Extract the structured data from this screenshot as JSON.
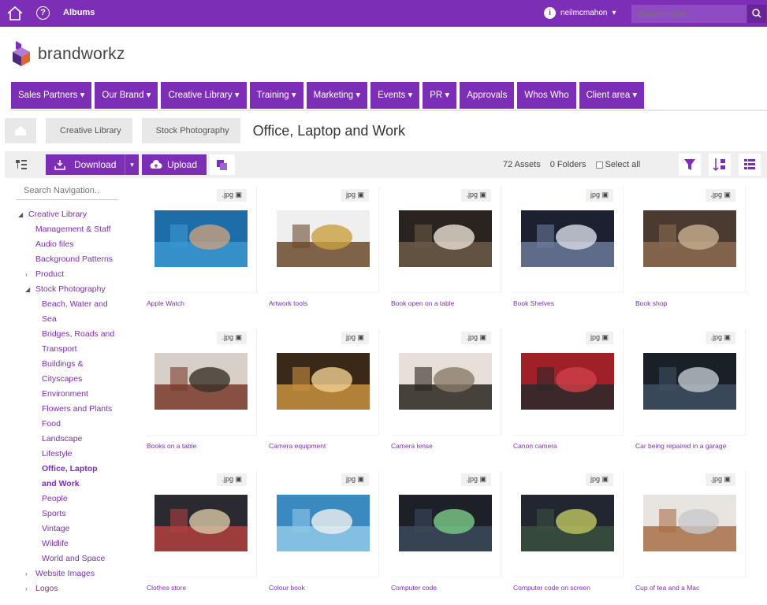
{
  "topbar": {
    "home_icon": "home-icon",
    "help_icon": "help-icon",
    "help_glyph": "?",
    "albums_label": "Albums",
    "user_initial": "i",
    "username": "neilmcmahon",
    "user_caret": "▾",
    "search_placeholder": "Search site..."
  },
  "brand": {
    "name": "brandworkz",
    "mark": "·"
  },
  "colors": {
    "accent": "#7c2fb6"
  },
  "nav": [
    {
      "label": "Sales Partners ▾"
    },
    {
      "label": "Our Brand ▾"
    },
    {
      "label": "Creative Library ▾"
    },
    {
      "label": "Training ▾"
    },
    {
      "label": "Marketing ▾"
    },
    {
      "label": "Events ▾"
    },
    {
      "label": "PR ▾"
    },
    {
      "label": "Approvals"
    },
    {
      "label": "Whos Who"
    },
    {
      "label": "Client area ▾"
    }
  ],
  "breadcrumb": {
    "items": [
      "Creative Library",
      "Stock Photography"
    ],
    "current": "Office, Laptop and Work"
  },
  "toolbar": {
    "download_label": "Download",
    "download_caret": "▾",
    "upload_label": "Upload",
    "assets": "72 Assets",
    "folders": "0 Folders",
    "select_all": "Select all"
  },
  "sidebar": {
    "search_placeholder": "Search Navigation..",
    "tree": [
      {
        "label": "Creative Library",
        "indent": 0,
        "arrow": "◢"
      },
      {
        "label": "Management & Staff",
        "indent": 1
      },
      {
        "label": "Audio files",
        "indent": 1
      },
      {
        "label": "Background Patterns",
        "indent": 1
      },
      {
        "label": "Product",
        "indent": 1,
        "arrow": "›"
      },
      {
        "label": "Stock Photography",
        "indent": 1,
        "arrow": "◢"
      },
      {
        "label": "Beach, Water and",
        "indent": 2
      },
      {
        "label": "Sea",
        "indent": 2
      },
      {
        "label": "Bridges, Roads and",
        "indent": 2
      },
      {
        "label": "Transport",
        "indent": 2
      },
      {
        "label": "Buildings &",
        "indent": 2
      },
      {
        "label": "Cityscapes",
        "indent": 2
      },
      {
        "label": "Environment",
        "indent": 2
      },
      {
        "label": "Flowers and Plants",
        "indent": 2
      },
      {
        "label": "Food",
        "indent": 2
      },
      {
        "label": "Landscape",
        "indent": 2
      },
      {
        "label": "Lifestyle",
        "indent": 2
      },
      {
        "label": "Office, Laptop",
        "indent": 2,
        "active": true
      },
      {
        "label": "and Work",
        "indent": 2,
        "active": true
      },
      {
        "label": "People",
        "indent": 2
      },
      {
        "label": "Sports",
        "indent": 2
      },
      {
        "label": "Vintage",
        "indent": 2
      },
      {
        "label": "Wildlife",
        "indent": 2
      },
      {
        "label": "World and Space",
        "indent": 2
      },
      {
        "label": "Website Images",
        "indent": 1,
        "arrow": "›"
      },
      {
        "label": "Logos",
        "indent": 1,
        "arrow": "›"
      }
    ]
  },
  "assets": [
    {
      "name": "Apple Watch",
      "type": ".jpg",
      "palette": [
        "#1d6ea8",
        "#3a97d0",
        "#c9a080"
      ]
    },
    {
      "name": "Artwork tools",
      "type": "jpg",
      "palette": [
        "#efefef",
        "#6b4a2c",
        "#c9a040"
      ]
    },
    {
      "name": "Book open on a table",
      "type": ".jpg",
      "palette": [
        "#2a2420",
        "#6b5a48",
        "#e9e1d4"
      ]
    },
    {
      "name": "Book Shelves",
      "type": "jpg",
      "palette": [
        "#1c2030",
        "#6a7a9a",
        "#d8dde8"
      ]
    },
    {
      "name": "Book shop",
      "type": ".jpg",
      "palette": [
        "#4a3a30",
        "#8b6a50",
        "#c8b090"
      ]
    },
    {
      "name": "Books on a table",
      "type": ".jpg",
      "palette": [
        "#d8d0c8",
        "#7a3a2a",
        "#3a3028"
      ]
    },
    {
      "name": "Camera equipment",
      "type": "jpg",
      "palette": [
        "#3a2818",
        "#c89040",
        "#f0d090"
      ]
    },
    {
      "name": "Camera lense",
      "type": ".jpg",
      "palette": [
        "#e8e0d8",
        "#2a2420",
        "#8a7a6a"
      ]
    },
    {
      "name": "Canon camera",
      "type": "jpg",
      "palette": [
        "#a02028",
        "#2a2a2a",
        "#d04048"
      ]
    },
    {
      "name": "Car being repaired in a garage",
      "type": ".jpg",
      "palette": [
        "#1a2028",
        "#405060",
        "#c0c8d0"
      ]
    },
    {
      "name": "Clothes store",
      "type": ".jpg",
      "palette": [
        "#2a2a30",
        "#b04040",
        "#d8c8a8"
      ]
    },
    {
      "name": "Colour book",
      "type": "jpg",
      "palette": [
        "#3a8ac0",
        "#90c8e8",
        "#f0f0f0"
      ]
    },
    {
      "name": "Computer code",
      "type": ".jpg",
      "palette": [
        "#1e2028",
        "#3a4a5a",
        "#7acc8a"
      ]
    },
    {
      "name": "Computer code on screen",
      "type": "jpg",
      "palette": [
        "#222630",
        "#3a5040",
        "#c0c860"
      ]
    },
    {
      "name": "Cup of tea and a Mac",
      "type": ".jpg",
      "palette": [
        "#e8e4e0",
        "#a87048",
        "#c8c8cc"
      ]
    }
  ]
}
